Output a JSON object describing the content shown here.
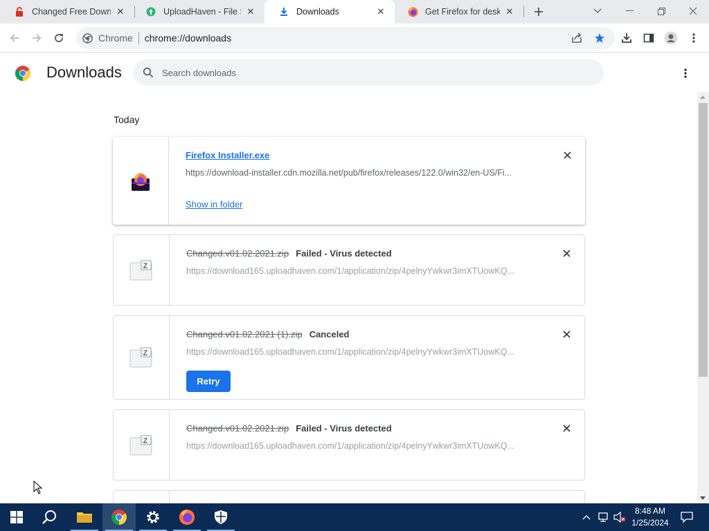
{
  "browser": {
    "tabs": [
      {
        "title": "Changed Free Downloads",
        "favicon": "red-lock-icon",
        "active": false
      },
      {
        "title": "UploadHaven - File Sharing",
        "favicon": "uploadhaven-icon",
        "active": false
      },
      {
        "title": "Downloads",
        "favicon": "download-icon",
        "active": true
      },
      {
        "title": "Get Firefox for desktop",
        "favicon": "firefox-icon",
        "active": false
      }
    ],
    "omnibox": {
      "site_label": "Chrome",
      "url": "chrome://downloads"
    },
    "accent_color": "#1a73e8"
  },
  "downloads": {
    "title": "Downloads",
    "search_placeholder": "Search downloads",
    "date_group": "Today",
    "items": [
      {
        "filename": "Firefox Installer.exe",
        "status": "",
        "url": "https://download-installer.cdn.mozilla.net/pub/firefox/releases/122.0/win32/en-US/Fi...",
        "action": "Show in folder"
      },
      {
        "filename": "Changed.v01.02.2021.zip",
        "status": "Failed - Virus detected",
        "url": "https://download165.uploadhaven.com/1/application/zip/4pelnyYwkwr3imXTUowKQ...",
        "action": ""
      },
      {
        "filename": "Changed.v01.02.2021 (1).zip",
        "status": "Canceled",
        "url": "https://download165.uploadhaven.com/1/application/zip/4pelnyYwkwr3imXTUowKQ...",
        "action": "Retry"
      },
      {
        "filename": "Changed.v01.02.2021.zip",
        "status": "Failed - Virus detected",
        "url": "https://download165.uploadhaven.com/1/application/zip/4pelnyYwkwr3imXTUowKQ...",
        "action": ""
      }
    ]
  },
  "taskbar": {
    "time": "8:48 AM",
    "date": "1/25/2024",
    "background": "#0b2b54"
  }
}
